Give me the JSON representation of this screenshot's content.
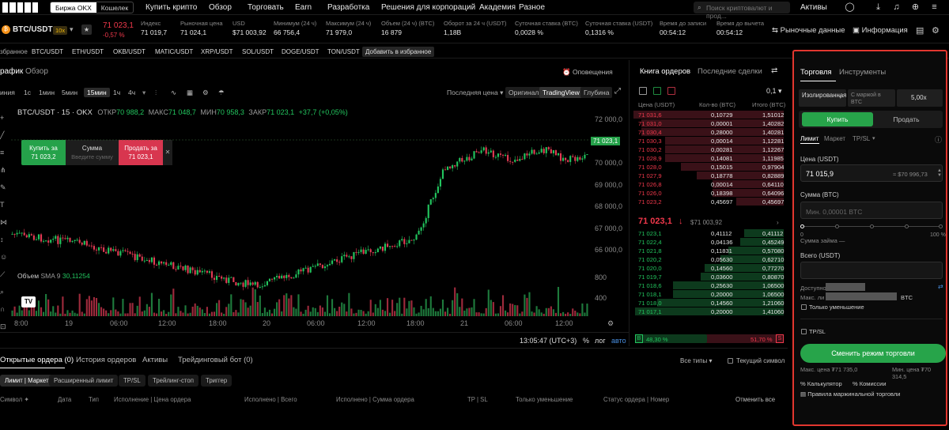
{
  "topnav": {
    "segments": [
      "Биржа OKX",
      "Кошелек"
    ],
    "items": [
      "Купить крипто",
      "Обзор",
      "Торговать",
      "Earn",
      "Разработка",
      "Решения для корпораций",
      "Академия",
      "Разное"
    ],
    "search_placeholder": "Поиск криптовалют и прод...",
    "assets_label": "Активы"
  },
  "ticker": {
    "pair": "BTC/USDT",
    "leverage": "10x",
    "price": "71 023,1",
    "change": "-0,57 %",
    "stats": [
      {
        "label": "Индекс",
        "value": "71 019,7"
      },
      {
        "label": "Рыночная цена",
        "value": "71 024,1"
      },
      {
        "label": "USD",
        "value": "$71 003,92"
      },
      {
        "label": "Минимум (24 ч)",
        "value": "66 756,4"
      },
      {
        "label": "Максимум (24 ч)",
        "value": "71 979,0"
      },
      {
        "label": "Объем (24 ч) (BTC)",
        "value": "16 879"
      },
      {
        "label": "Оборот за 24 ч (USDT)",
        "value": "1,18B"
      },
      {
        "label": "Суточная ставка (BTC)",
        "value": "0,0028 %"
      },
      {
        "label": "Суточная ставка (USDT)",
        "value": "0,1316 %"
      },
      {
        "label": "Время до записи",
        "value": "00:54:12"
      },
      {
        "label": "Время до вычета",
        "value": "00:54:12"
      }
    ],
    "market_data": "Рыночные данные",
    "info": "Информация"
  },
  "favbar": {
    "label": "збранное",
    "items": [
      "BTC/USDT",
      "ETH/USDT",
      "OKB/USDT",
      "MATIC/USDT",
      "XRP/USDT",
      "SOL/USDT",
      "DOGE/USDT",
      "TON/USDT"
    ],
    "add": "Добавить в избранное"
  },
  "chart": {
    "tabs": [
      "рафик",
      "Обзор"
    ],
    "alerts": "Оповещения",
    "timeframes": [
      "иния",
      "1с",
      "1мин",
      "5мин",
      "15мин",
      "1ч",
      "4ч"
    ],
    "active_tf": "15мин",
    "price_type": "Последняя цена",
    "views": [
      "Оригинал",
      "TradingView",
      "Глубина"
    ],
    "legend": "BTC/USDT · 15 · OKX",
    "ohlc": [
      {
        "k": "ОТКР",
        "v": "70 988,2"
      },
      {
        "k": "МАКС",
        "v": "71 048,7"
      },
      {
        "k": "МИН",
        "v": "70 958,3"
      },
      {
        "k": "ЗАКР",
        "v": "71 023,1"
      }
    ],
    "ohlc_change": "+37,7 (+0,05%)",
    "buy_label": "Купить за",
    "buy_price": "71 023,2",
    "amount_label": "Сумма",
    "amount_placeholder": "Введите сумму",
    "sell_label": "Продать за",
    "sell_price": "71 023,1",
    "last_price_tag": "71 023,1",
    "y_ticks": [
      "72 000,0",
      "71 000,0",
      "70 000,0",
      "69 000,0",
      "68 000,0",
      "67 000,0",
      "66 000,0"
    ],
    "vol_label": "Объем",
    "vol_sma": "SMA 9",
    "vol_value": "30,11254",
    "vol_ticks": [
      "800",
      "400"
    ],
    "x_ticks": [
      "8:00",
      "19",
      "06:00",
      "12:00",
      "18:00",
      "20",
      "06:00",
      "12:00",
      "18:00",
      "21",
      "06:00",
      "12:00"
    ],
    "time": "13:05:47 (UTC+3)",
    "pct": "%",
    "log": "лог",
    "auto": "авто"
  },
  "book": {
    "tabs": [
      "Книга ордеров",
      "Последние сделки"
    ],
    "step": "0,1",
    "headers": [
      "Цена (USDT)",
      "Кол-во (BTC)",
      "Итого (BTC)"
    ],
    "asks": [
      [
        "71 031,6",
        "0,10729",
        "1,51012"
      ],
      [
        "71 031,0",
        "0,00001",
        "1,40282"
      ],
      [
        "71 030,4",
        "0,28000",
        "1,40281"
      ],
      [
        "71 030,3",
        "0,00014",
        "1,12281"
      ],
      [
        "71 030,2",
        "0,00281",
        "1,12267"
      ],
      [
        "71 028,9",
        "0,14081",
        "1,11985"
      ],
      [
        "71 028,0",
        "0,15015",
        "0,97904"
      ],
      [
        "71 027,9",
        "0,18778",
        "0,82889"
      ],
      [
        "71 026,8",
        "0,00014",
        "0,64110"
      ],
      [
        "71 026,0",
        "0,18398",
        "0,64096"
      ],
      [
        "71 023,2",
        "0,45697",
        "0,45697"
      ]
    ],
    "mid_price": "71 023,1",
    "mid_usd": "$71 003,92",
    "bids": [
      [
        "71 023,1",
        "0,41112",
        "0,41112"
      ],
      [
        "71 022,4",
        "0,04136",
        "0,45249"
      ],
      [
        "71 021,8",
        "0,11831",
        "0,57080"
      ],
      [
        "71 020,2",
        "0,05630",
        "0,62710"
      ],
      [
        "71 020,0",
        "0,14560",
        "0,77270"
      ],
      [
        "71 019,7",
        "0,03600",
        "0,80870"
      ],
      [
        "71 018,6",
        "0,25630",
        "1,06500"
      ],
      [
        "71 018,1",
        "0,20000",
        "1,06500"
      ],
      [
        "71 018,0",
        "0,14560",
        "1,21060"
      ],
      [
        "71 017,1",
        "0,20000",
        "1,41060"
      ]
    ],
    "ratio_buy": "48,30 %",
    "ratio_sell": "51,70 %",
    "ratio_buy_fraction": 0.483,
    "b": "B",
    "s": "S"
  },
  "trade": {
    "tabs": [
      "Торговля",
      "Инструменты"
    ],
    "margin_mode": "Изолированная",
    "margin_sub": "С маржой в BTC",
    "leverage": "5,00x",
    "buy": "Купить",
    "sell": "Продать",
    "order_types": [
      "Лимит",
      "Маркет",
      "TP/SL"
    ],
    "price_label": "Цена (USDT)",
    "price_value": "71 015,9",
    "price_usd": "≈ $70 996,73",
    "amount_label": "Сумма (BTC)",
    "amount_placeholder": "Мин. 0,00001 BTC",
    "slider_min": "0",
    "slider_max": "100 %",
    "loan": "Сумма займа —",
    "total_label": "Всего (USDT)",
    "available": "Доступно",
    "max": "Макс. ли",
    "max_unit": "BTC",
    "reduce_only": "Только уменьшение",
    "tpsl": "TP/SL",
    "switch_mode": "Сменить режим торговли",
    "max_price": "Макс. цена ₮71 735,0",
    "min_price": "Мин. цена ₮70 314,5",
    "calculator": "Калькулятор",
    "fees": "Комиссии",
    "rules": "Правила маржинальной торговли"
  },
  "bottom": {
    "tabs": [
      "Открытые ордера (0)",
      "История ордеров",
      "Активы",
      "Трейдинговый бот (0)"
    ],
    "all_types": "Все типы",
    "current_symbol": "Текущий символ",
    "chips": [
      "Лимит | Маркет",
      "Расширенный лимит",
      "TP/SL",
      "Трейлинг-стоп",
      "Триггер"
    ],
    "columns": [
      "Символ",
      "Дата",
      "Тип",
      "Исполнение | Цена ордера",
      "Исполнено | Всего",
      "Исполнено | Сумма ордера",
      "TP | SL",
      "Только уменьшение",
      "Статус ордера | Номер",
      "Отменить все"
    ]
  }
}
